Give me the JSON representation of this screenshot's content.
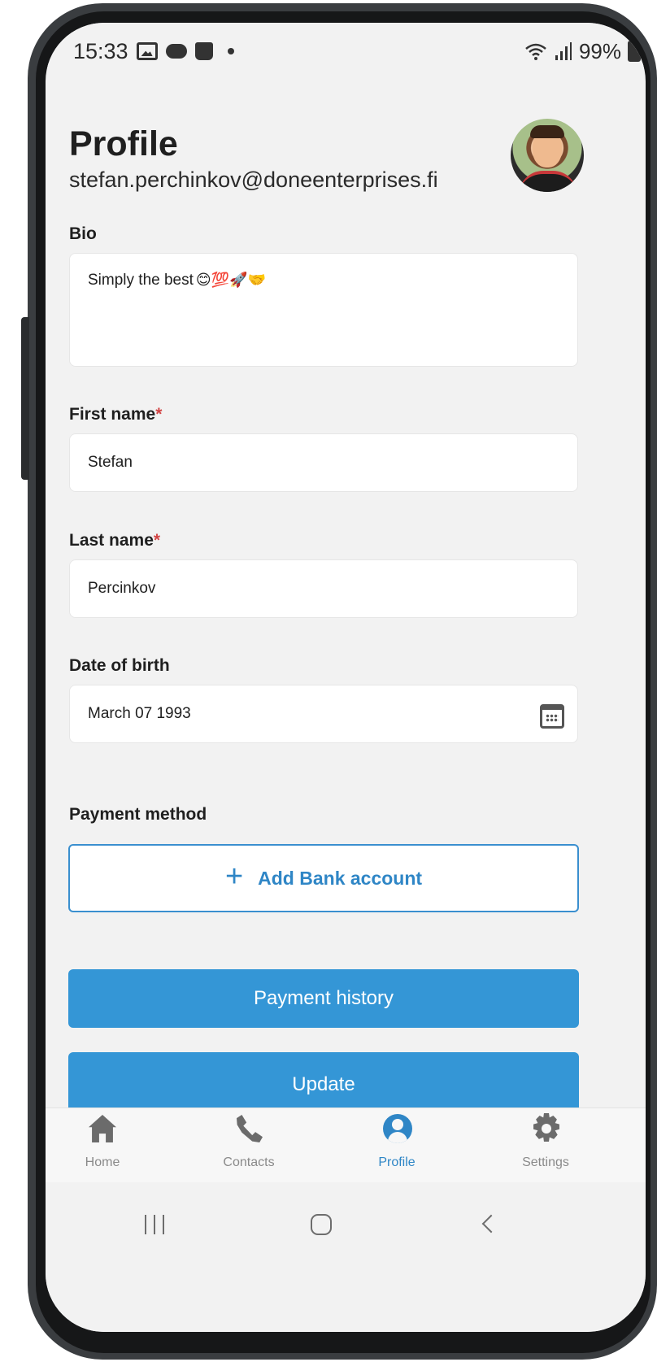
{
  "status_bar": {
    "time": "15:33",
    "battery": "99%",
    "icons": [
      "gallery-icon",
      "game-icon",
      "shopping-bag-icon",
      "dot-icon",
      "wifi-icon",
      "signal-icon",
      "battery-charging-icon"
    ]
  },
  "header": {
    "title": "Profile",
    "email": "stefan.perchinkov@doneenterprises.fi"
  },
  "form": {
    "bio": {
      "label": "Bio",
      "value": "Simply the best",
      "emojis": "😊💯🚀🤝"
    },
    "first_name": {
      "label": "First name",
      "required_mark": "*",
      "value": "Stefan"
    },
    "last_name": {
      "label": "Last name",
      "required_mark": "*",
      "value": "Percinkov"
    },
    "date_of_birth": {
      "label": "Date of birth",
      "value": "March 07 1993",
      "icon": "calendar-icon"
    },
    "payment_method": {
      "label": "Payment method",
      "add_button": "Add Bank account",
      "add_icon": "plus-icon"
    }
  },
  "buttons": {
    "payment_history": "Payment history",
    "update": "Update"
  },
  "bottom_nav": {
    "items": [
      {
        "label": "Home",
        "icon": "home-icon",
        "active": false
      },
      {
        "label": "Contacts",
        "icon": "phone-icon",
        "active": false
      },
      {
        "label": "Profile",
        "icon": "user-circle-icon",
        "active": true
      },
      {
        "label": "Settings",
        "icon": "gear-icon",
        "active": false
      }
    ]
  },
  "colors": {
    "accent": "#3496d6",
    "accent_text": "#2f86c6",
    "required": "#d24545",
    "background": "#f2f2f2"
  }
}
